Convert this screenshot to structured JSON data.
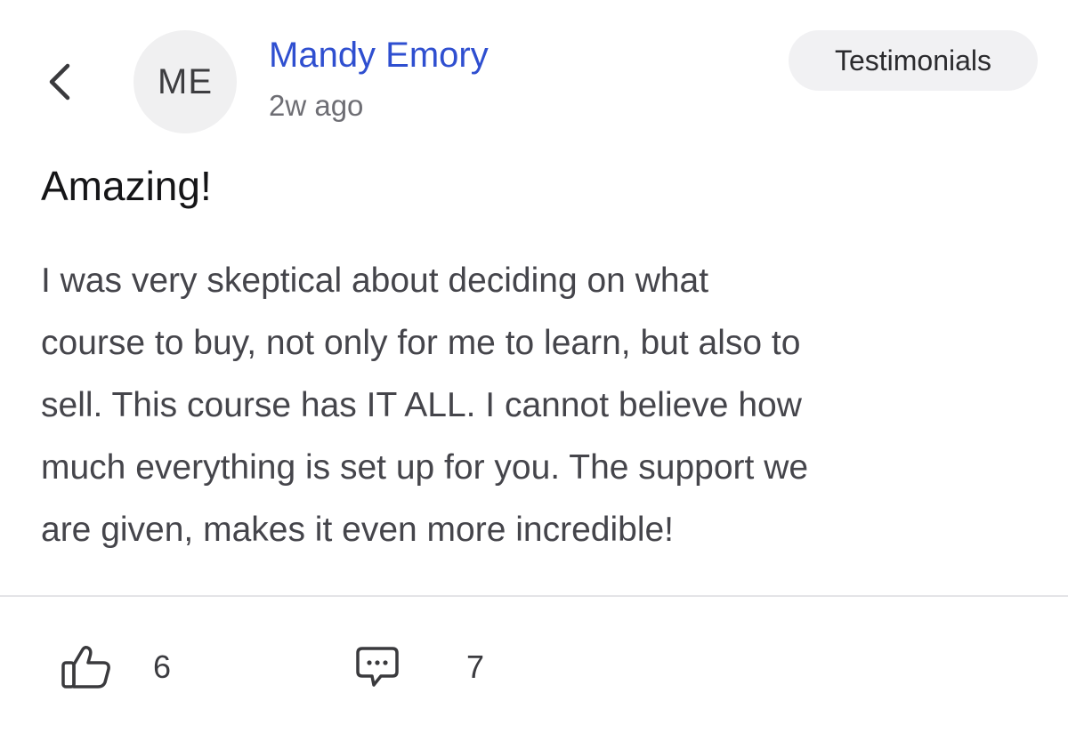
{
  "header": {
    "back_icon": "chevron-left-icon",
    "avatar_initials": "ME",
    "author_name": "Mandy Emory",
    "post_time": "2w ago",
    "category": "Testimonials"
  },
  "post": {
    "title": "Amazing!",
    "body_lines": [
      "I was very skeptical about deciding on what",
      "course to buy, not only for me to learn, but also to",
      "sell. This course has IT ALL. I cannot believe how",
      "much everything is set up for you. The support we",
      "are given, makes it even more incredible!"
    ]
  },
  "actions": {
    "like_icon": "thumbs-up-icon",
    "like_count": "6",
    "comment_icon": "comment-icon",
    "comment_count": "7"
  },
  "colors": {
    "author_link": "#2f4fd0",
    "chip_background": "#f1f1f3",
    "avatar_background": "#f0f0f1"
  }
}
